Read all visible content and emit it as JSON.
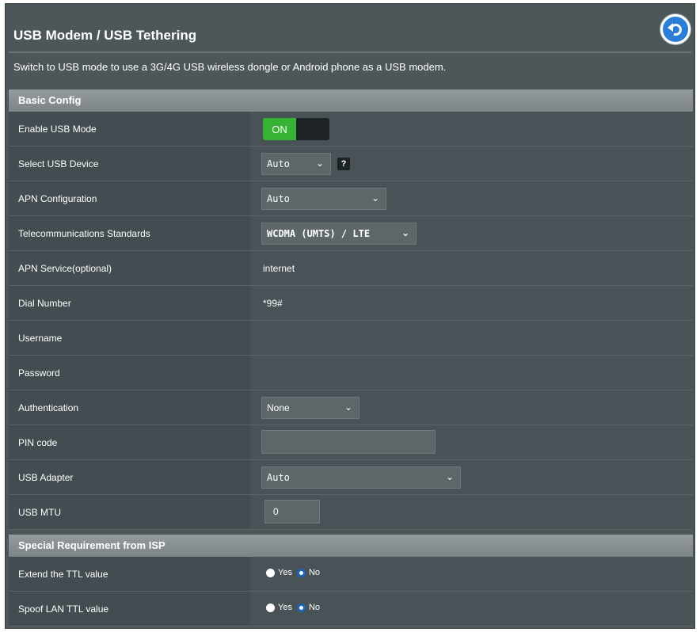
{
  "header": {
    "title": "USB Modem / USB Tethering",
    "back_icon": "back-arrow-icon"
  },
  "description": "Switch to USB mode to use a 3G/4G USB wireless dongle or Android phone as a USB modem.",
  "sections": {
    "basic": "Basic Config",
    "isp": "Special Requirement from ISP"
  },
  "fields": {
    "enable_usb_mode": {
      "label": "Enable USB Mode",
      "value": "ON"
    },
    "select_usb_device": {
      "label": "Select USB Device",
      "value": "Auto",
      "help": "?"
    },
    "apn_config": {
      "label": "APN Configuration",
      "value": "Auto"
    },
    "telecom_standards": {
      "label": "Telecommunications Standards",
      "value": "WCDMA (UMTS) / LTE"
    },
    "apn_service": {
      "label": "APN Service(optional)",
      "value": "internet"
    },
    "dial_number": {
      "label": "Dial Number",
      "value": "*99#"
    },
    "username": {
      "label": "Username",
      "value": ""
    },
    "password": {
      "label": "Password",
      "value": ""
    },
    "authentication": {
      "label": "Authentication",
      "value": "None"
    },
    "pin_code": {
      "label": "PIN code",
      "value": ""
    },
    "usb_adapter": {
      "label": "USB Adapter",
      "value": "Auto"
    },
    "usb_mtu": {
      "label": "USB MTU",
      "value": "0"
    }
  },
  "isp": {
    "extend_ttl": {
      "label": "Extend the TTL value",
      "yes": "Yes",
      "no": "No",
      "selected": "No"
    },
    "spoof_ttl": {
      "label": "Spoof LAN TTL value",
      "yes": "Yes",
      "no": "No",
      "selected": "No"
    }
  },
  "colors": {
    "on_green": "#36b334",
    "radio_blue": "#1e63b8",
    "back_blue": "#2a7ed6"
  }
}
